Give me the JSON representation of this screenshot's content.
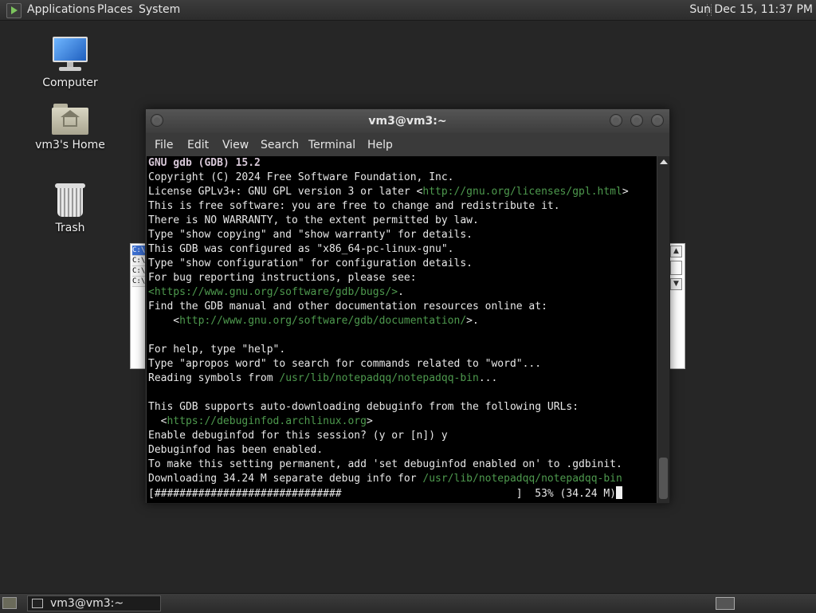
{
  "top_panel": {
    "menus": [
      "Applications",
      "Places",
      "System"
    ],
    "clock": "Sun Dec 15, 11:37 PM"
  },
  "desktop_icons": [
    {
      "label": "Computer",
      "icon": "computer-icon"
    },
    {
      "label": "vm3's Home",
      "icon": "home-folder-icon"
    },
    {
      "label": "Trash",
      "icon": "trash-icon"
    }
  ],
  "background_window": {
    "rows": [
      "C:\\",
      "C:\\",
      "C:\\",
      "C:\\"
    ]
  },
  "terminal": {
    "title": "vm3@vm3:~",
    "menu": [
      "File",
      "Edit",
      "View",
      "Search",
      "Terminal",
      "Help"
    ],
    "lines": [
      "GNU gdb (GDB) 15.2",
      "Copyright (C) 2024 Free Software Foundation, Inc.",
      "License GPLv3+: GNU GPL version 3 or later <",
      "http://gnu.org/licenses/gpl.html",
      ">",
      "This is free software: you are free to change and redistribute it.",
      "There is NO WARRANTY, to the extent permitted by law.",
      "Type \"show copying\" and \"show warranty\" for details.",
      "This GDB was configured as \"x86_64-pc-linux-gnu\".",
      "Type \"show configuration\" for configuration details.",
      "For bug reporting instructions, please see:",
      "<https://www.gnu.org/software/gdb/bugs/>",
      ".",
      "Find the GDB manual and other documentation resources online at:",
      "    <",
      "http://www.gnu.org/software/gdb/documentation/",
      ">.",
      "For help, type \"help\".",
      "Type \"apropos word\" to search for commands related to \"word\"...",
      "Reading symbols from ",
      "/usr/lib/notepadqq/notepadqq-bin",
      "...",
      "This GDB supports auto-downloading debuginfo from the following URLs:",
      "  <",
      "https://debuginfod.archlinux.org",
      ">",
      "Enable debuginfod for this session? (y or [n]) y",
      "Debuginfod has been enabled.",
      "To make this setting permanent, add 'set debuginfod enabled on' to .gdbinit.",
      "Downloading 34.24 M separate debug info for ",
      "/usr/lib/notepadqq/notepadqq-bin",
      "[##############################                            ]  53% (34.24 M)"
    ]
  },
  "taskbar": {
    "task_label": "vm3@vm3:~"
  },
  "colors": {
    "link_green": "#4e9a4e",
    "terminal_bg": "#000000",
    "desktop_bg": "#262626"
  }
}
